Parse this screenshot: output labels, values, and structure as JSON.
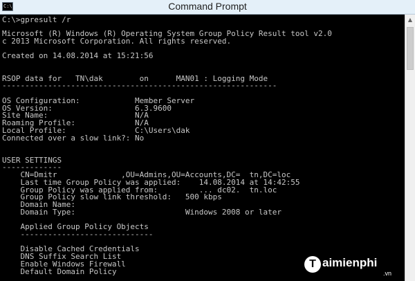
{
  "window": {
    "title": "Command Prompt",
    "icon_label": "C:\\",
    "icon": "console-icon"
  },
  "console": {
    "lines": [
      "C:\\>gpresult /r",
      "",
      "Microsoft (R) Windows (R) Operating System Group Policy Result tool v2.0",
      "c 2013 Microsoft Corporation. All rights reserved.",
      "",
      "Created on 14.08.2014 at 15:21:56",
      "",
      "",
      "RSOP data for   TN\\dak        on      MAN01 : Logging Mode",
      "------------------------------------------------------------",
      "",
      "OS Configuration:            Member Server",
      "OS Version:                  6.3.9600",
      "Site Name:                   N/A",
      "Roaming Profile:             N/A",
      "Local Profile:               C:\\Users\\dak",
      "Connected over a slow link?: No",
      "",
      "",
      "USER SETTINGS",
      "-------------",
      "    CN=Dmitr              ,OU=Admins,OU=Accounts,DC=  tn,DC=loc",
      "    Last time Group Policy was applied:    14.08.2014 at 14:42:55",
      "    Group Policy was applied from:         ... dc02.  tn.loc",
      "    Group Policy slow link threshold:   500 kbps",
      "    Domain Name:",
      "    Domain Type:                        Windows 2008 or later",
      "",
      "    Applied Group Policy Objects",
      "    -----------------------------",
      "",
      "    Disable Cached Credentials",
      "    DNS Suffix Search List",
      "    Enable Windows Firewall",
      "    Default Domain Policy"
    ]
  },
  "scrollbar": {
    "up_icon": "arrow-up-icon",
    "down_icon": "arrow-down-icon"
  },
  "watermark": {
    "logo_letter": "T",
    "brand": "aimienphi",
    "domain": ".vn"
  }
}
